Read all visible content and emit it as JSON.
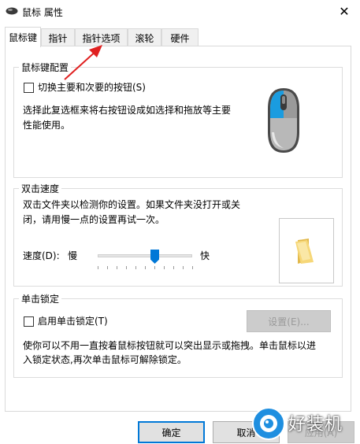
{
  "window": {
    "title": "鼠标 属性",
    "close_glyph": "✕"
  },
  "tabs": [
    {
      "label": "鼠标键",
      "active": true
    },
    {
      "label": "指针",
      "active": false
    },
    {
      "label": "指针选项",
      "active": false
    },
    {
      "label": "滚轮",
      "active": false
    },
    {
      "label": "硬件",
      "active": false
    }
  ],
  "button_config": {
    "title": "鼠标键配置",
    "swap_checkbox_label": "切换主要和次要的按钮(S)",
    "swap_checked": false,
    "description_line1": "选择此复选框来将右按钮设成如选择和拖放等主要",
    "description_line2": "性能使用。"
  },
  "double_click": {
    "title": "双击速度",
    "description_line1": "双击文件夹以检测你的设置。如果文件夹没打开或关",
    "description_line2": "闭，请用慢一点的设置再试一次。",
    "speed_label": "速度(D):",
    "slow_label": "慢",
    "fast_label": "快",
    "speed_value_fraction": 0.6
  },
  "click_lock": {
    "title": "单击锁定",
    "enable_label": "启用单击锁定(T)",
    "enable_checked": false,
    "settings_button": "设置(E)...",
    "description_line1": "使你可以不用一直按着鼠标按钮就可以突出显示或拖拽。单击鼠标以进",
    "description_line2": "入锁定状态,再次单击鼠标可解除锁定。"
  },
  "footer": {
    "ok_label": "确定",
    "cancel_label": "取消",
    "apply_label": "应用(A)"
  },
  "watermark": {
    "text": "好装机"
  },
  "colors": {
    "accent": "#0078d7",
    "annotation_arrow": "#e02020"
  }
}
